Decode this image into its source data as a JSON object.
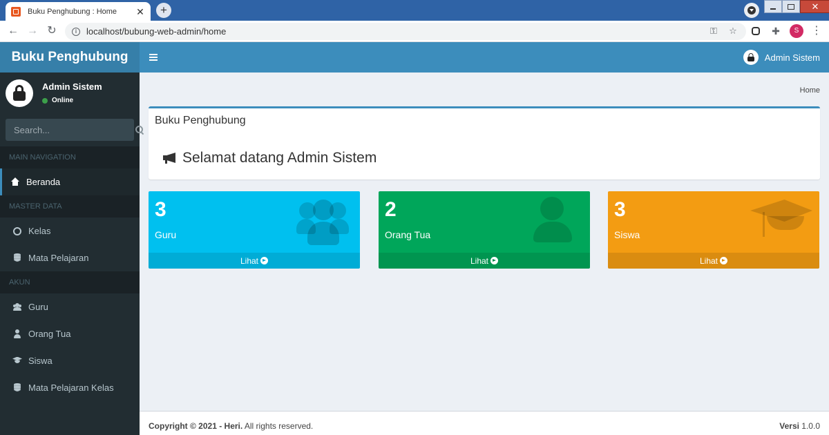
{
  "browser": {
    "tab_title": "Buku Penghubung : Home",
    "tab_close": "✕",
    "new_tab": "+",
    "url": "localhost/bubung-web-admin/home",
    "profile_initial": "S",
    "nav_back": "←",
    "nav_forward": "→",
    "nav_reload": "↻",
    "key_icon": "⚿",
    "star_icon": "☆",
    "kebab": "⋮",
    "info": "i"
  },
  "header": {
    "logo": "Buku Penghubung",
    "user_name": "Admin Sistem"
  },
  "sidebar": {
    "user_name": "Admin Sistem",
    "user_status": "Online",
    "search_placeholder": "Search...",
    "sections": [
      {
        "header": "MAIN NAVIGATION",
        "items": [
          {
            "label": "Beranda",
            "icon": "home-icon",
            "active": true
          }
        ]
      },
      {
        "header": "MASTER DATA",
        "items": [
          {
            "label": "Kelas",
            "icon": "circle-icon"
          },
          {
            "label": "Mata Pelajaran",
            "icon": "database-icon"
          }
        ]
      },
      {
        "header": "AKUN",
        "items": [
          {
            "label": "Guru",
            "icon": "users-icon"
          },
          {
            "label": "Orang Tua",
            "icon": "user-icon"
          },
          {
            "label": "Siswa",
            "icon": "graduation-cap-icon"
          },
          {
            "label": "Mata Pelajaran Kelas",
            "icon": "database-icon"
          }
        ]
      }
    ]
  },
  "content": {
    "breadcrumb": "Home",
    "box_title": "Buku Penghubung",
    "welcome": "Selamat datang Admin Sistem",
    "stats": [
      {
        "value": "3",
        "label": "Guru",
        "link": "Lihat",
        "color": "#00c0ef",
        "icon": "users-icon"
      },
      {
        "value": "2",
        "label": "Orang Tua",
        "link": "Lihat",
        "color": "#00a65a",
        "icon": "user-icon"
      },
      {
        "value": "3",
        "label": "Siswa",
        "link": "Lihat",
        "color": "#f39c12",
        "icon": "graduation-cap-icon"
      }
    ]
  },
  "footer": {
    "copyright_bold": "Copyright © 2021 - Heri.",
    "copyright_rest": " All rights reserved.",
    "version_label": "Versi",
    "version": " 1.0.0"
  },
  "colors": {
    "header": "#3c8dbc",
    "logo_bg": "#367fa9",
    "sidebar": "#222d32",
    "content_bg": "#ecf0f5"
  }
}
